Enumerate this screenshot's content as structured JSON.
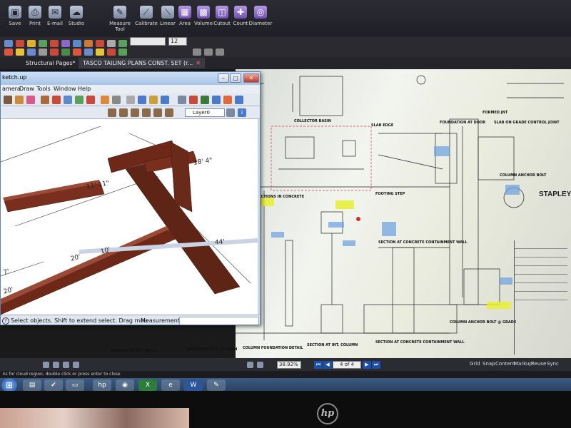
{
  "ribbon": {
    "buttons": [
      {
        "label": "Save",
        "icon": "save-icon"
      },
      {
        "label": "Print",
        "icon": "print-icon"
      },
      {
        "label": "E-mail",
        "icon": "email-icon"
      },
      {
        "label": "Studio",
        "icon": "studio-icon"
      },
      {
        "label": "Measure Tool",
        "icon": "measure-icon"
      },
      {
        "label": "Calibrate",
        "icon": "calibrate-icon"
      },
      {
        "label": "Linear",
        "icon": "linear-icon"
      },
      {
        "label": "Area",
        "icon": "area-icon"
      },
      {
        "label": "Volume",
        "icon": "volume-icon"
      },
      {
        "label": "Cutout",
        "icon": "cutout-icon"
      },
      {
        "label": "Count",
        "icon": "count-icon"
      },
      {
        "label": "Diameter",
        "icon": "diameter-icon"
      }
    ]
  },
  "toolbar": {
    "font_size": "12"
  },
  "tabs": {
    "structural_pages": "Structural Pages*",
    "document": "TASCO TAILING PLANS CONST. SET (r..."
  },
  "sketchup": {
    "title": "ketch.up",
    "menu": [
      "amera",
      "Draw",
      "Tools",
      "Window",
      "Help"
    ],
    "layer": "Layer0",
    "status_hint": "Select objects. Shift to extend select. Drag mou",
    "measurements_label": "Measurements",
    "dimensions": [
      "18' 4\"",
      "11' 11\"",
      "44'",
      "20'",
      "10'",
      "20'",
      "7'"
    ]
  },
  "sheet": {
    "company": "STAPLEY",
    "labels": [
      "COLLECTOR BASIN",
      "SLAB EDGE",
      "FOUNDATION AT DOOR",
      "SLAB ON GRADE CONTROL JOINT",
      "INTERSECTIONS IN CONCRETE",
      "FOOTING STEP",
      "COLUMN ANCHOR BOLT",
      "SECTION AT CONCRETE CONTAINMENT WALL",
      "COLUMN ANCHOR BOLT @ GRADE",
      "SECTION AT EXT. WALL",
      "SECTION AT EXT. COLUMN",
      "COLUMN FOUNDATION DETAIL",
      "SECTION AT INT. COLUMN",
      "SECTION AT CONCRETE CONTAINMENT WALL",
      "FORMED JNT"
    ]
  },
  "viewer_status": {
    "zoom": "38.92%",
    "page": "4 of 4",
    "grid": "Grid",
    "snap": "Snap",
    "content": "Content",
    "markup": "Markup",
    "reuse": "Reuse",
    "sync": "Sync"
  },
  "hint_bar": "ks for cloud region, double click or press enter to close",
  "taskbar": {
    "apps": [
      "ie-icon",
      "explorer-icon",
      "folder-icon",
      "hp-icon",
      "firefox-icon",
      "excel-icon",
      "ie-icon",
      "word-icon",
      "paint-icon"
    ]
  },
  "monitor": {
    "brand": "hp"
  }
}
